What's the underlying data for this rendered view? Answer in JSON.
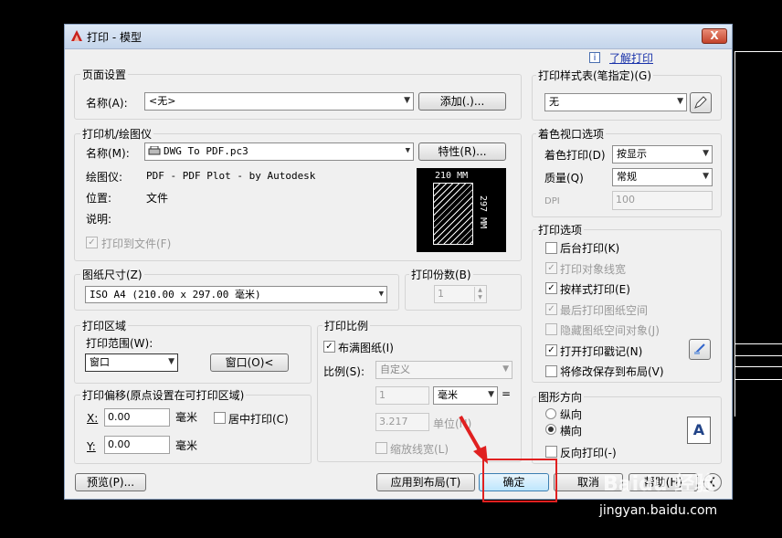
{
  "window": {
    "title": "打印 - 模型",
    "close_label": "X",
    "help_link": "了解打印",
    "info_icon": "i"
  },
  "page_setup": {
    "group": "页面设置",
    "name_label": "名称(A):",
    "name_value": "<无>",
    "add_button": "添加(.)..."
  },
  "printer": {
    "group": "打印机/绘图仪",
    "name_label": "名称(M):",
    "name_value": "DWG To PDF.pc3",
    "properties_button": "特性(R)...",
    "plotter_label": "绘图仪:",
    "plotter_value": "PDF - PDF Plot - by Autodesk",
    "location_label": "位置:",
    "location_value": "文件",
    "description_label": "说明:",
    "print_to_file": "打印到文件(F)",
    "preview_width": "210 MM",
    "preview_height": "297 MM"
  },
  "paper_size": {
    "group": "图纸尺寸(Z)",
    "value": "ISO A4 (210.00 x 297.00 毫米)"
  },
  "copies": {
    "group": "打印份数(B)",
    "value": "1"
  },
  "plot_area": {
    "group": "打印区域",
    "range_label": "打印范围(W):",
    "range_value": "窗口",
    "window_button": "窗口(O)<"
  },
  "plot_offset": {
    "group": "打印偏移(原点设置在可打印区域)",
    "x_label": "X:",
    "x_value": "0.00",
    "x_unit": "毫米",
    "y_label": "Y:",
    "y_value": "0.00",
    "y_unit": "毫米",
    "center_label": "居中打印(C)"
  },
  "plot_scale": {
    "group": "打印比例",
    "fit_label": "布满图纸(I)",
    "scale_label": "比例(S):",
    "scale_value": "自定义",
    "value1": "1",
    "unit_value": "毫米",
    "equals": "=",
    "value2": "3.217",
    "unit_label": "单位(N)",
    "lineweights_label": "缩放线宽(L)"
  },
  "plot_style_table": {
    "group": "打印样式表(笔指定)(G)",
    "value": "无"
  },
  "shaded_viewport": {
    "group": "着色视口选项",
    "shade_label": "着色打印(D)",
    "shade_value": "按显示",
    "quality_label": "质量(Q)",
    "quality_value": "常规",
    "dpi_label": "DPI",
    "dpi_value": "100"
  },
  "plot_options": {
    "group": "打印选项",
    "items": [
      {
        "label": "后台打印(K)",
        "checked": false,
        "disabled": false
      },
      {
        "label": "打印对象线宽",
        "checked": true,
        "disabled": true
      },
      {
        "label": "按样式打印(E)",
        "checked": true,
        "disabled": false
      },
      {
        "label": "最后打印图纸空间",
        "checked": true,
        "disabled": true
      },
      {
        "label": "隐藏图纸空间对象(J)",
        "checked": false,
        "disabled": true
      },
      {
        "label": "打开打印戳记(N)",
        "checked": true,
        "disabled": false
      },
      {
        "label": "将修改保存到布局(V)",
        "checked": false,
        "disabled": false
      }
    ]
  },
  "orientation": {
    "group": "图形方向",
    "portrait": "纵向",
    "landscape": "横向",
    "reverse": "反向打印(-)",
    "icon_letter": "A"
  },
  "buttons": {
    "preview": "预览(P)...",
    "apply": "应用到布局(T)",
    "ok": "确定",
    "cancel": "取消",
    "help": "帮助(H)"
  },
  "watermark": {
    "site": "jingyan.baidu.com",
    "brand": "Baidu 经验"
  }
}
